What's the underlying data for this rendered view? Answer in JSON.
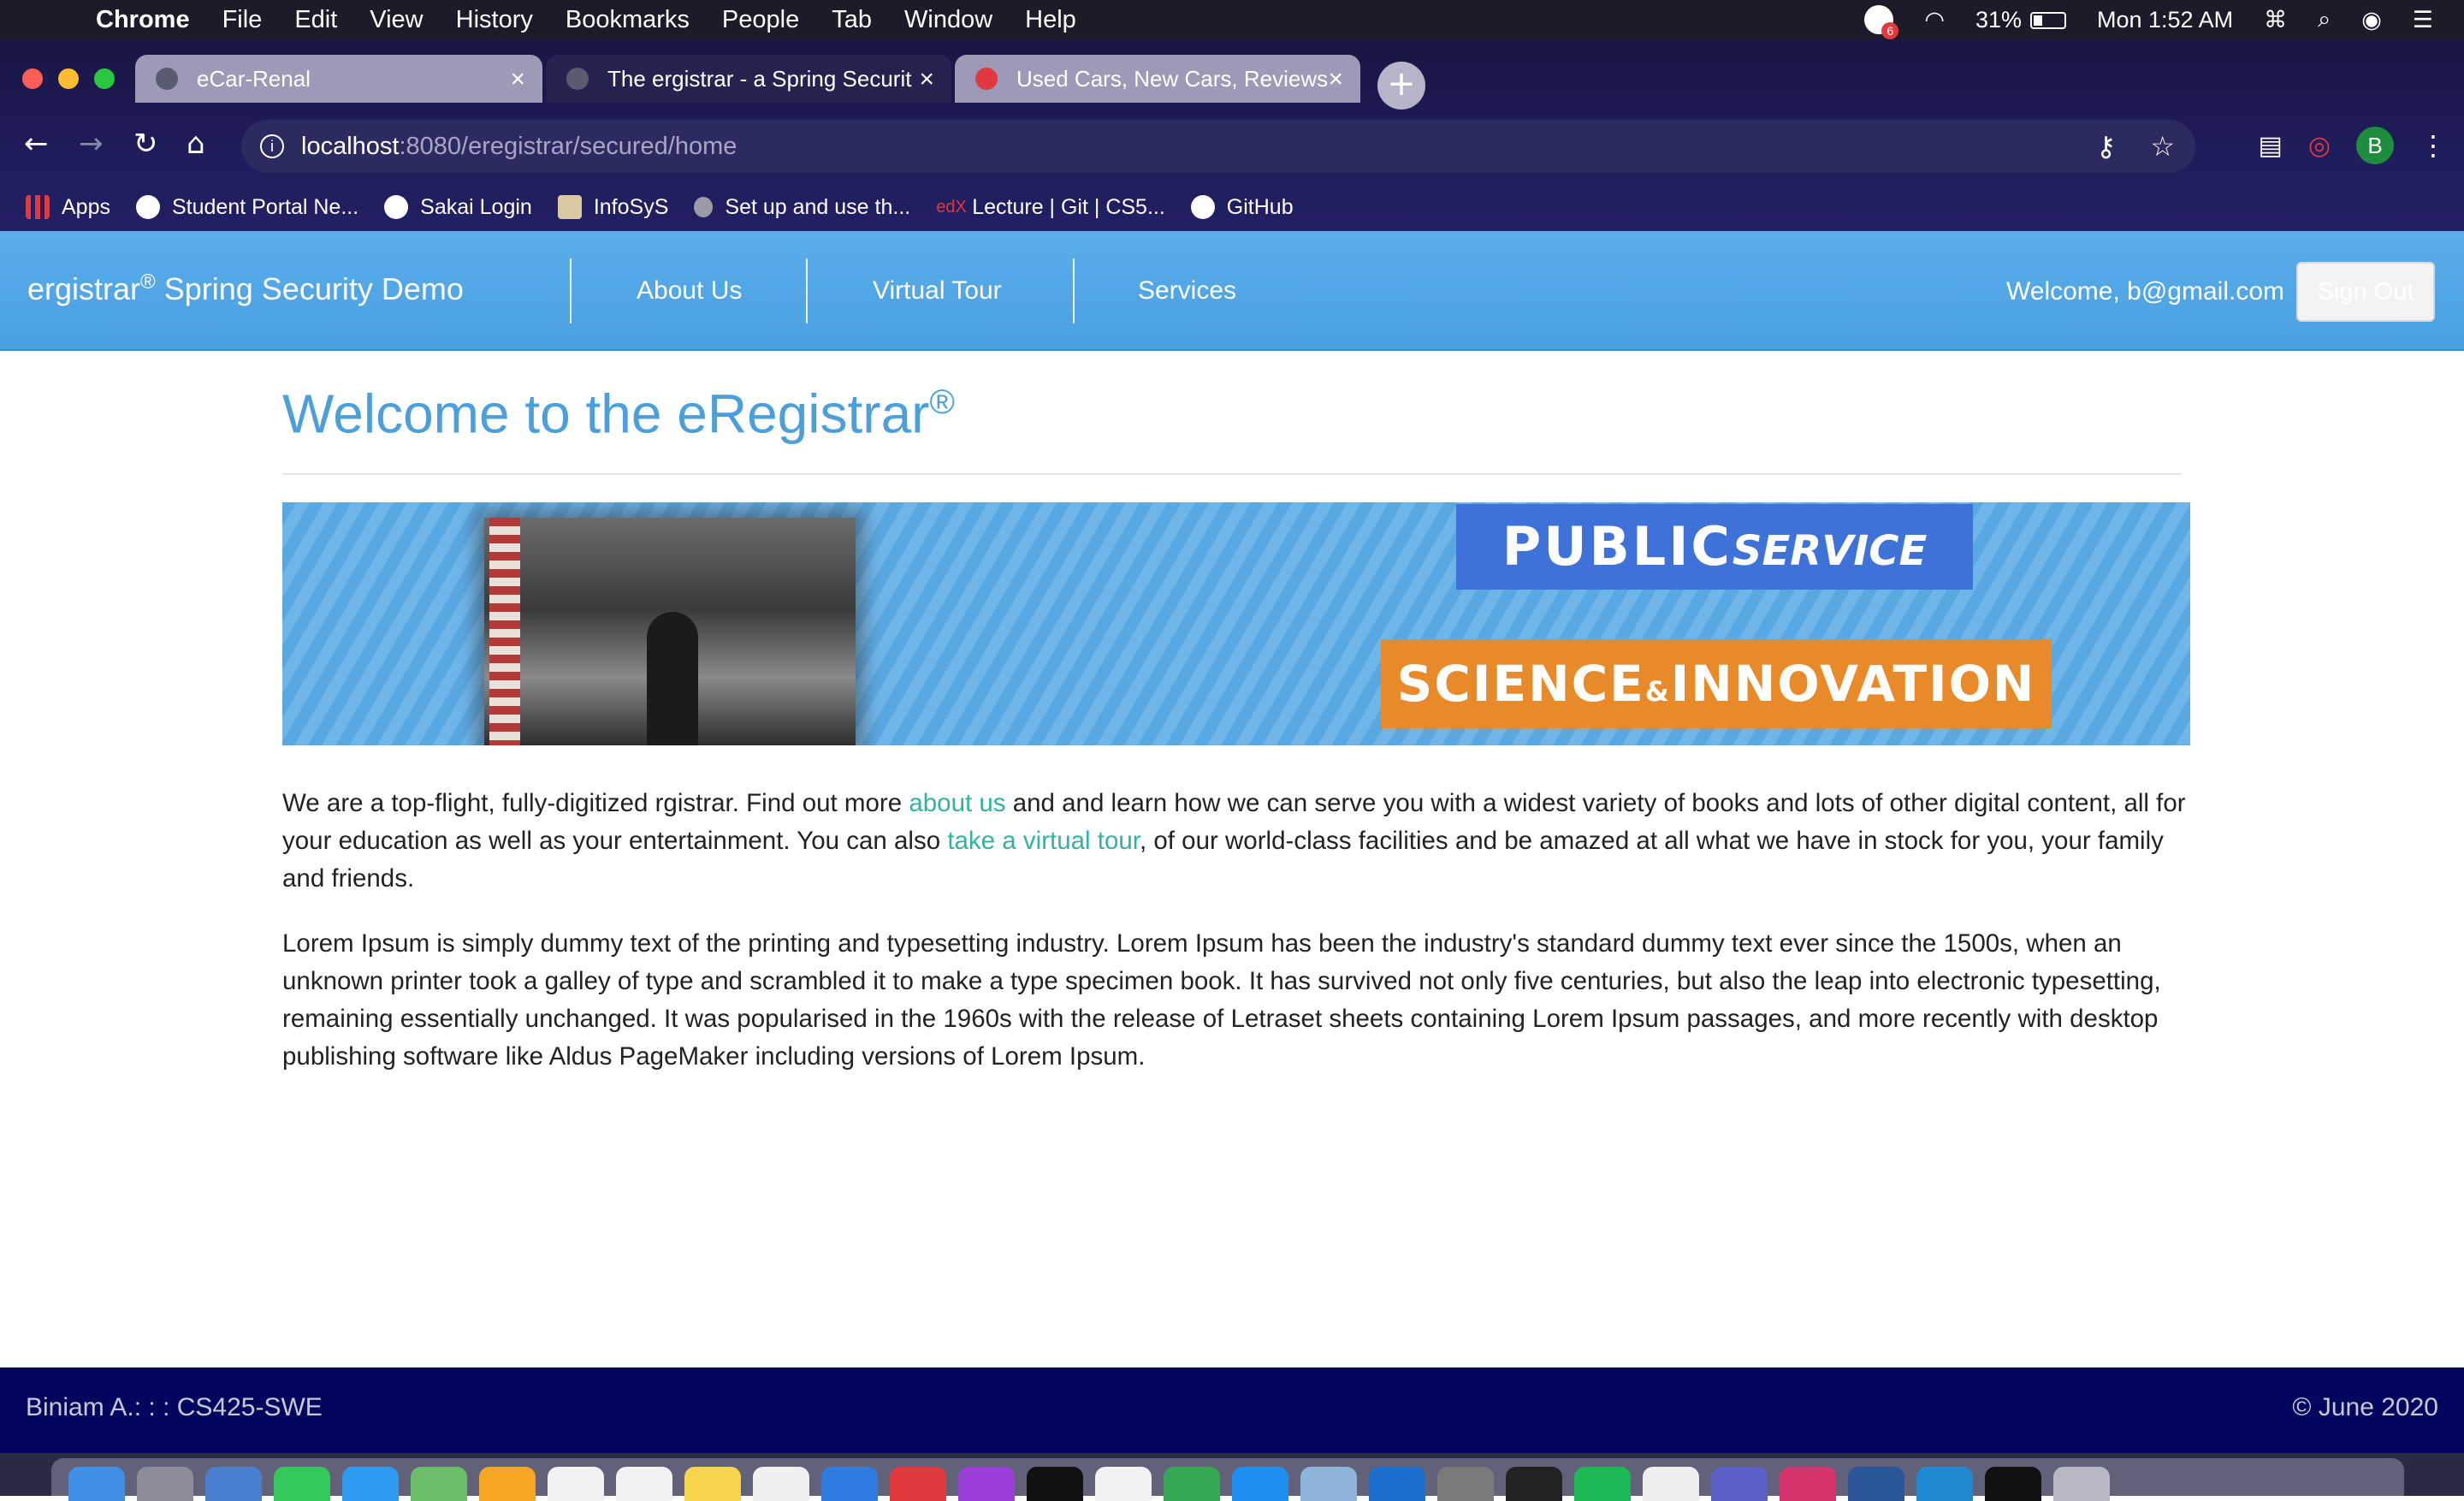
{
  "menubar": {
    "app": "Chrome",
    "items": [
      "File",
      "Edit",
      "View",
      "History",
      "Bookmarks",
      "People",
      "Tab",
      "Window",
      "Help"
    ],
    "battery": "31%",
    "clock": "Mon 1:52 AM",
    "notification_count": "6"
  },
  "tabs": [
    {
      "title": "eCar-Renal",
      "close": "×"
    },
    {
      "title": "The ergistrar - a Spring Securit",
      "close": "×"
    },
    {
      "title": "Used Cars, New Cars, Reviews",
      "close": "×"
    }
  ],
  "newtab": "+",
  "address": {
    "host": "localhost",
    "path": ":8080/eregistrar/secured/home"
  },
  "profile_initial": "B",
  "bookmarks": [
    {
      "label": "Apps",
      "icon": "apps-grid-icon"
    },
    {
      "label": "Student Portal Ne...",
      "icon": "globe-icon"
    },
    {
      "label": "Sakai Login",
      "icon": "globe-icon"
    },
    {
      "label": "InfoSyS",
      "icon": "infosys-icon"
    },
    {
      "label": "Set up and use th...",
      "icon": "apple-icon"
    },
    {
      "label": "Lecture | Git | CS5...",
      "icon": "edx-icon"
    },
    {
      "label": "GitHub",
      "icon": "github-icon"
    }
  ],
  "site": {
    "brand": "ergistrar",
    "brand_mark": "®",
    "brand_rest": " Spring Security Demo",
    "nav": [
      "About Us",
      "Virtual Tour",
      "Services"
    ],
    "welcome": "Welcome,  b@gmail.com",
    "signout": "Sign Out"
  },
  "main": {
    "heading": "Welcome to the eRegistrar",
    "heading_mark": "®",
    "banner": {
      "public_bold": "PUBLIC",
      "public_italic": "SERVICE",
      "sci_1": "SCIENCE",
      "sci_amp": "&",
      "sci_2": "INNOVATION"
    },
    "p1_a": "We are a top-flight, fully-digitized rgistrar. Find out more ",
    "p1_link1": "about us",
    "p1_b": " and and learn how we can serve you with a widest variety of books and lots of other digital content, all for your education as well as your entertainment. You can also ",
    "p1_link2": "take a virtual tour",
    "p1_c": ", of our world-class facilities and be amazed at all what we have in stock for you, your family and friends.",
    "p2": "Lorem Ipsum is simply dummy text of the printing and typesetting industry. Lorem Ipsum has been the industry's standard dummy text ever since the 1500s, when an unknown printer took a galley of type and scrambled it to make a type specimen book. It has survived not only five centuries, but also the leap into electronic typesetting, remaining essentially unchanged. It was popularised in the 1960s with the release of Letraset sheets containing Lorem Ipsum passages, and more recently with desktop publishing software like Aldus PageMaker including versions of Lorem Ipsum."
  },
  "footer": {
    "left": "Biniam A.: : : CS425-SWE",
    "right": "© June 2020"
  }
}
